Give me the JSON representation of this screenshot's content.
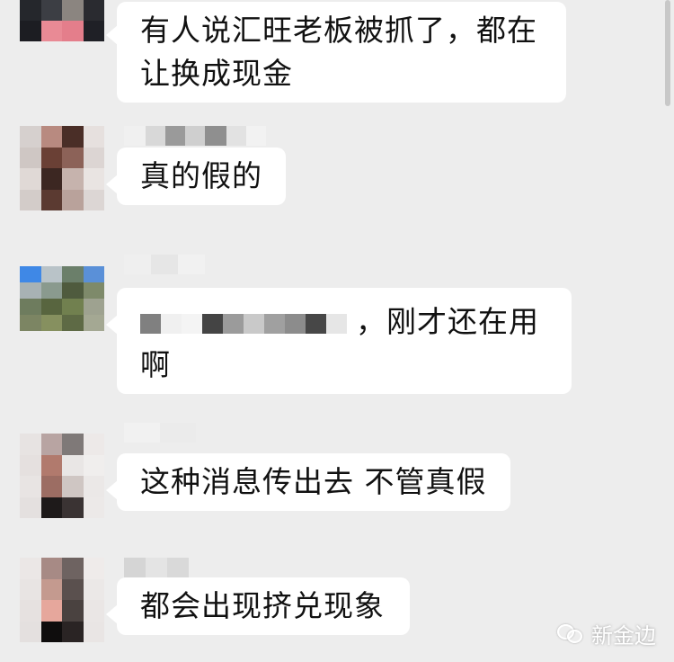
{
  "messages": [
    {
      "text": "有人说汇旺老板被抓了，都在让换成现金"
    },
    {
      "text": "真的假的"
    },
    {
      "text": "，刚才还在用啊"
    },
    {
      "text": "这种消息传出去 不管真假"
    },
    {
      "text": "都会出现挤兑现象"
    }
  ],
  "watermark": {
    "text": "新金边"
  }
}
